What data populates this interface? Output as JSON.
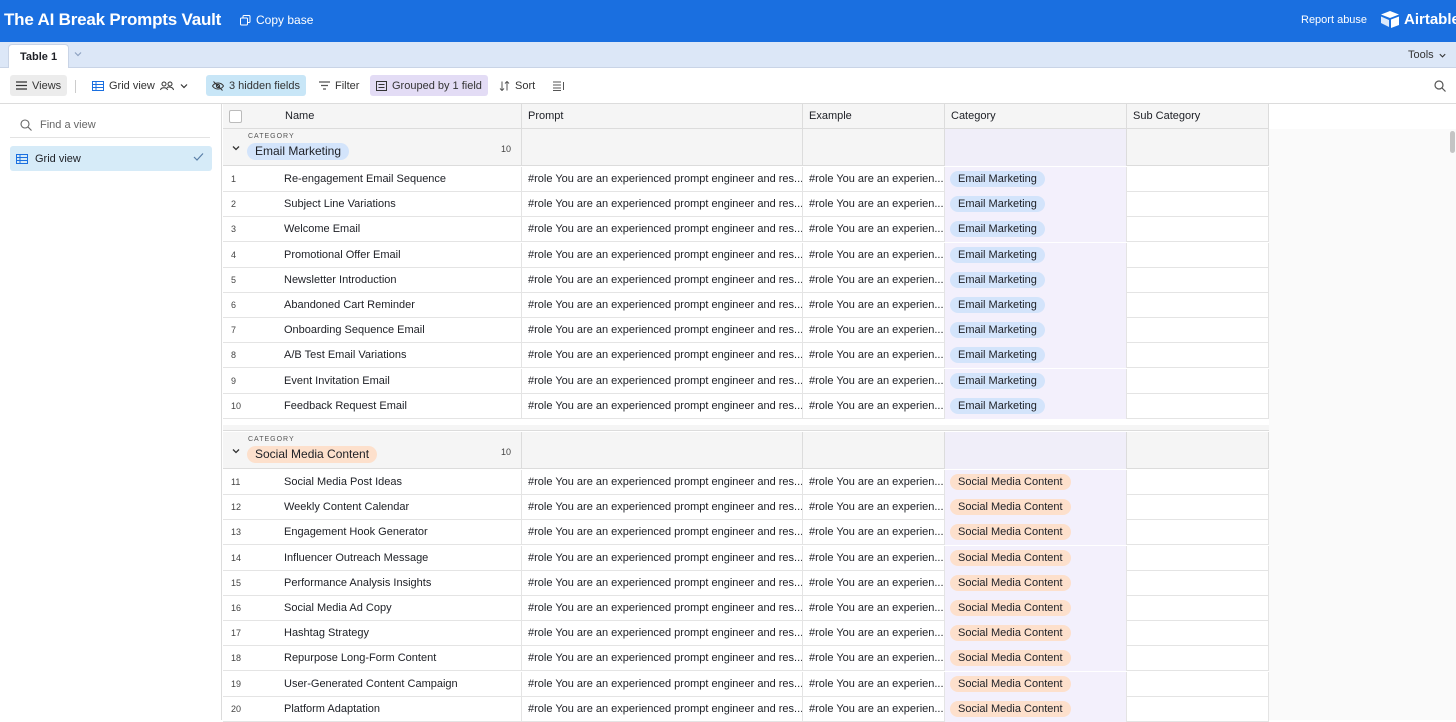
{
  "app": {
    "title": "The AI Break Prompts Vault",
    "copy_base_label": "Copy base",
    "report_abuse_label": "Report abuse",
    "brand_name": "Airtable",
    "brand_color": "#1a6fe0"
  },
  "tabs": {
    "active_tab": "Table 1",
    "tools_label": "Tools"
  },
  "toolbar": {
    "views_label": "Views",
    "grid_view_label": "Grid view",
    "hidden_fields_label": "3 hidden fields",
    "filter_label": "Filter",
    "grouped_label": "Grouped by 1 field",
    "sort_label": "Sort"
  },
  "sidebar": {
    "find_placeholder": "Find a view",
    "views": [
      {
        "label": "Grid view",
        "selected": true
      }
    ]
  },
  "grid": {
    "columns": [
      "Name",
      "Prompt",
      "Example",
      "Category",
      "Sub Category"
    ],
    "group_label": "CATEGORY",
    "groups": [
      {
        "name": "Email Marketing",
        "count": "10",
        "color": "#d3e4fb",
        "rows": [
          {
            "num": "1",
            "name": "Re-engagement Email Sequence",
            "prompt": "#role You are an experienced prompt engineer and res...",
            "example": "#role You are an experien...",
            "category": "Email Marketing",
            "sub": ""
          },
          {
            "num": "2",
            "name": "Subject Line Variations",
            "prompt": "#role You are an experienced prompt engineer and res...",
            "example": "#role You are an experien...",
            "category": "Email Marketing",
            "sub": ""
          },
          {
            "num": "3",
            "name": "Welcome Email",
            "prompt": "#role You are an experienced prompt engineer and res...",
            "example": "#role You are an experien...",
            "category": "Email Marketing",
            "sub": ""
          },
          {
            "num": "4",
            "name": "Promotional Offer Email",
            "prompt": "#role You are an experienced prompt engineer and res...",
            "example": "#role You are an experien...",
            "category": "Email Marketing",
            "sub": ""
          },
          {
            "num": "5",
            "name": "Newsletter Introduction",
            "prompt": "#role You are an experienced prompt engineer and res...",
            "example": "#role You are an experien...",
            "category": "Email Marketing",
            "sub": ""
          },
          {
            "num": "6",
            "name": "Abandoned Cart Reminder",
            "prompt": "#role You are an experienced prompt engineer and res...",
            "example": "#role You are an experien...",
            "category": "Email Marketing",
            "sub": ""
          },
          {
            "num": "7",
            "name": "Onboarding Sequence Email",
            "prompt": "#role You are an experienced prompt engineer and res...",
            "example": "#role You are an experien...",
            "category": "Email Marketing",
            "sub": ""
          },
          {
            "num": "8",
            "name": "A/B Test Email Variations",
            "prompt": "#role You are an experienced prompt engineer and res...",
            "example": "#role You are an experien...",
            "category": "Email Marketing",
            "sub": ""
          },
          {
            "num": "9",
            "name": "Event Invitation Email",
            "prompt": "#role You are an experienced prompt engineer and res...",
            "example": "#role You are an experien...",
            "category": "Email Marketing",
            "sub": ""
          },
          {
            "num": "10",
            "name": "Feedback Request Email",
            "prompt": "#role You are an experienced prompt engineer and res...",
            "example": "#role You are an experien...",
            "category": "Email Marketing",
            "sub": ""
          }
        ]
      },
      {
        "name": "Social Media Content",
        "count": "10",
        "color": "#fde0cc",
        "rows": [
          {
            "num": "11",
            "name": "Social Media Post Ideas",
            "prompt": "#role You are an experienced prompt engineer and res...",
            "example": "#role You are an experien...",
            "category": "Social Media Content",
            "sub": ""
          },
          {
            "num": "12",
            "name": "Weekly Content Calendar",
            "prompt": "#role You are an experienced prompt engineer and res...",
            "example": "#role You are an experien...",
            "category": "Social Media Content",
            "sub": ""
          },
          {
            "num": "13",
            "name": "Engagement Hook Generator",
            "prompt": "#role You are an experienced prompt engineer and res...",
            "example": "#role You are an experien...",
            "category": "Social Media Content",
            "sub": ""
          },
          {
            "num": "14",
            "name": "Influencer Outreach Message",
            "prompt": "#role You are an experienced prompt engineer and res...",
            "example": "#role You are an experien...",
            "category": "Social Media Content",
            "sub": ""
          },
          {
            "num": "15",
            "name": "Performance Analysis Insights",
            "prompt": "#role You are an experienced prompt engineer and res...",
            "example": "#role You are an experien...",
            "category": "Social Media Content",
            "sub": ""
          },
          {
            "num": "16",
            "name": "Social Media Ad Copy",
            "prompt": "#role You are an experienced prompt engineer and res...",
            "example": "#role You are an experien...",
            "category": "Social Media Content",
            "sub": ""
          },
          {
            "num": "17",
            "name": "Hashtag Strategy",
            "prompt": "#role You are an experienced prompt engineer and res...",
            "example": "#role You are an experien...",
            "category": "Social Media Content",
            "sub": ""
          },
          {
            "num": "18",
            "name": "Repurpose Long-Form Content",
            "prompt": "#role You are an experienced prompt engineer and res...",
            "example": "#role You are an experien...",
            "category": "Social Media Content",
            "sub": ""
          },
          {
            "num": "19",
            "name": "User-Generated Content Campaign",
            "prompt": "#role You are an experienced prompt engineer and res...",
            "example": "#role You are an experien...",
            "category": "Social Media Content",
            "sub": ""
          },
          {
            "num": "20",
            "name": "Platform Adaptation",
            "prompt": "#role You are an experienced prompt engineer and res...",
            "example": "#role You are an experien...",
            "category": "Social Media Content",
            "sub": ""
          }
        ]
      }
    ]
  }
}
